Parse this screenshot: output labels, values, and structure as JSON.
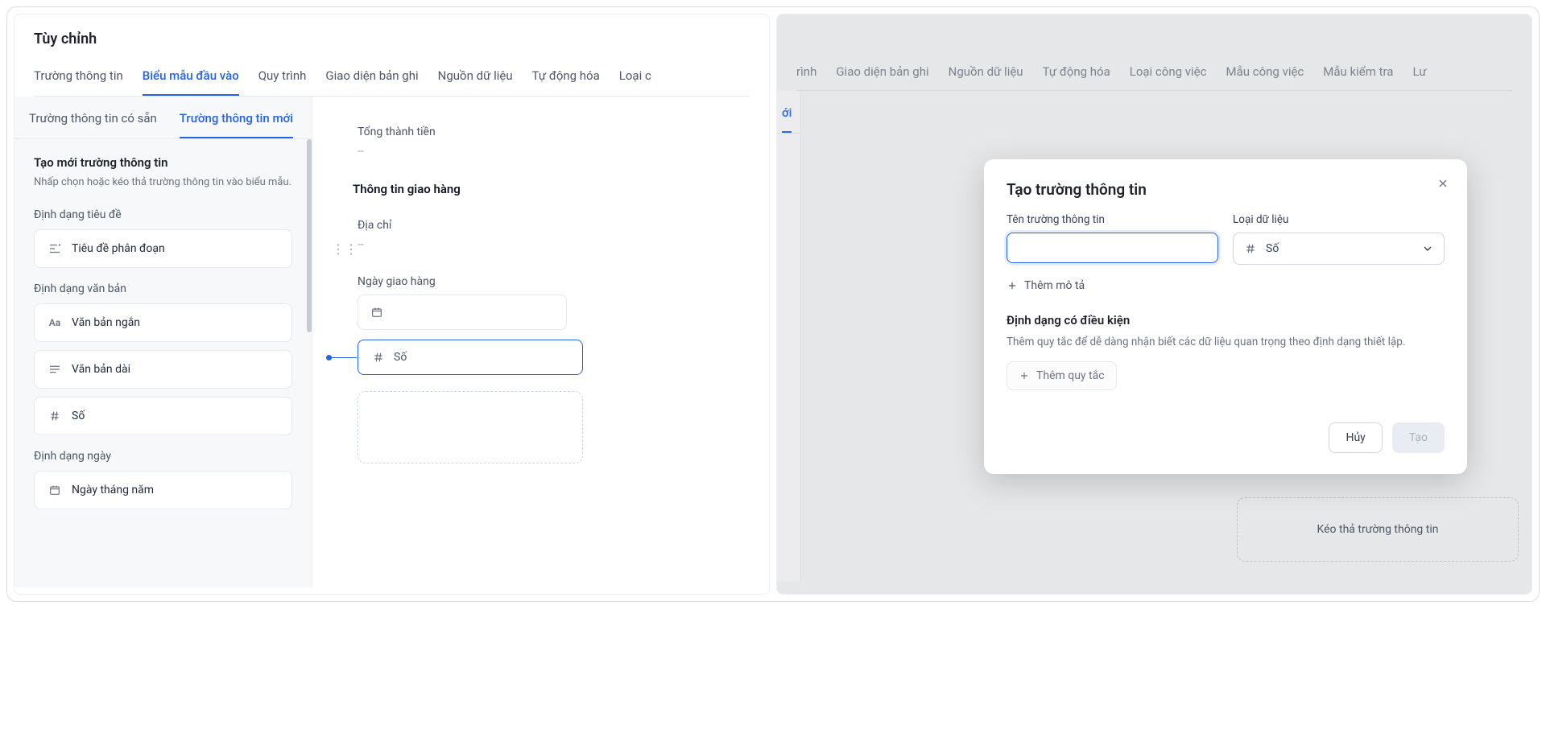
{
  "left": {
    "title": "Tùy chỉnh",
    "tabs": [
      "Trường thông tin",
      "Biểu mẫu đầu vào",
      "Quy trình",
      "Giao diện bản ghi",
      "Nguồn dữ liệu",
      "Tự động hóa",
      "Loại c"
    ],
    "activeTab": 1,
    "subtabs": [
      "Trường thông tin có sẵn",
      "Trường thông tin mới"
    ],
    "activeSubtab": 1,
    "create": {
      "title": "Tạo mới trường thông tin",
      "desc": "Nhấp chọn hoặc kéo thả trường thông tin vào biểu mẫu."
    },
    "groups": {
      "heading": "Định dạng tiêu đề",
      "headingItem": "Tiêu đề phân đoạn",
      "text": "Định dạng văn bản",
      "shortText": "Văn bản ngắn",
      "longText": "Văn bản dài",
      "number": "Số",
      "date": "Định dạng ngày",
      "dateItem": "Ngày tháng năm"
    },
    "form": {
      "totalLabel": "Tổng thành tiền",
      "totalVal": "--",
      "section": "Thông tin giao hàng",
      "addressLabel": "Địa chỉ",
      "addressVal": "--",
      "dateLabel": "Ngày giao hàng",
      "insertLabel": "Số"
    }
  },
  "right": {
    "tabs": [
      "rình",
      "Giao diện bản ghi",
      "Nguồn dữ liệu",
      "Tự động hóa",
      "Loại công việc",
      "Mẫu công việc",
      "Mẫu kiểm tra",
      "Lư"
    ],
    "subtabActive": "ới",
    "dropPlaceholder": "Kéo thả trường thông tin",
    "modal": {
      "title": "Tạo trường thông tin",
      "nameLabel": "Tên trường thông tin",
      "typeLabel": "Loại dữ liệu",
      "typeValue": "Số",
      "addDesc": "Thêm mô tả",
      "condTitle": "Định dạng có điều kiện",
      "condDesc": "Thêm quy tắc để dễ dàng nhận biết các dữ liệu quan trọng theo định dạng thiết lập.",
      "addRule": "Thêm quy tắc",
      "cancel": "Hủy",
      "create": "Tạo"
    }
  }
}
